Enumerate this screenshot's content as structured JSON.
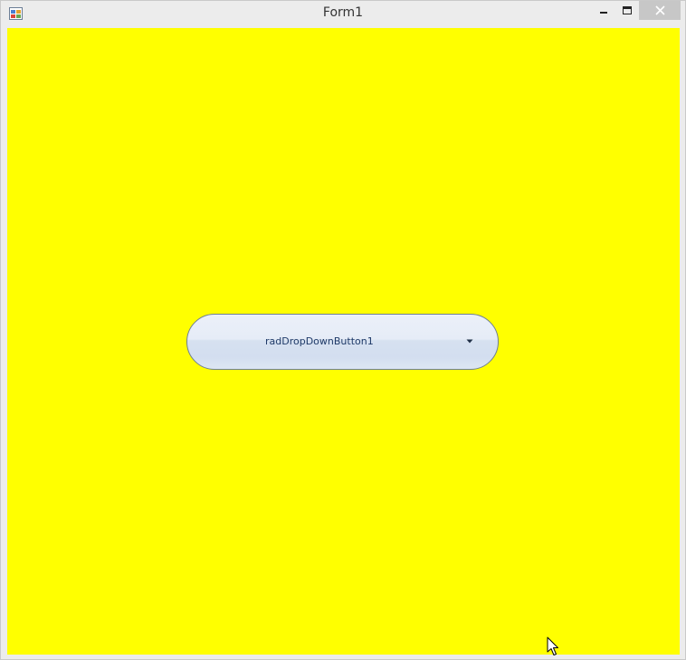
{
  "window": {
    "title": "Form1",
    "client_color": "#ffff00",
    "controls": {
      "minimize_icon": "minimize-icon",
      "maximize_icon": "maximize-icon",
      "close_icon": "close-icon"
    }
  },
  "dropdown_button": {
    "label": "radDropDownButton1",
    "arrow_icon": "dropdown-arrow-icon",
    "text_color": "#1f3a68"
  },
  "cursor": {
    "icon": "mouse-pointer-icon"
  }
}
